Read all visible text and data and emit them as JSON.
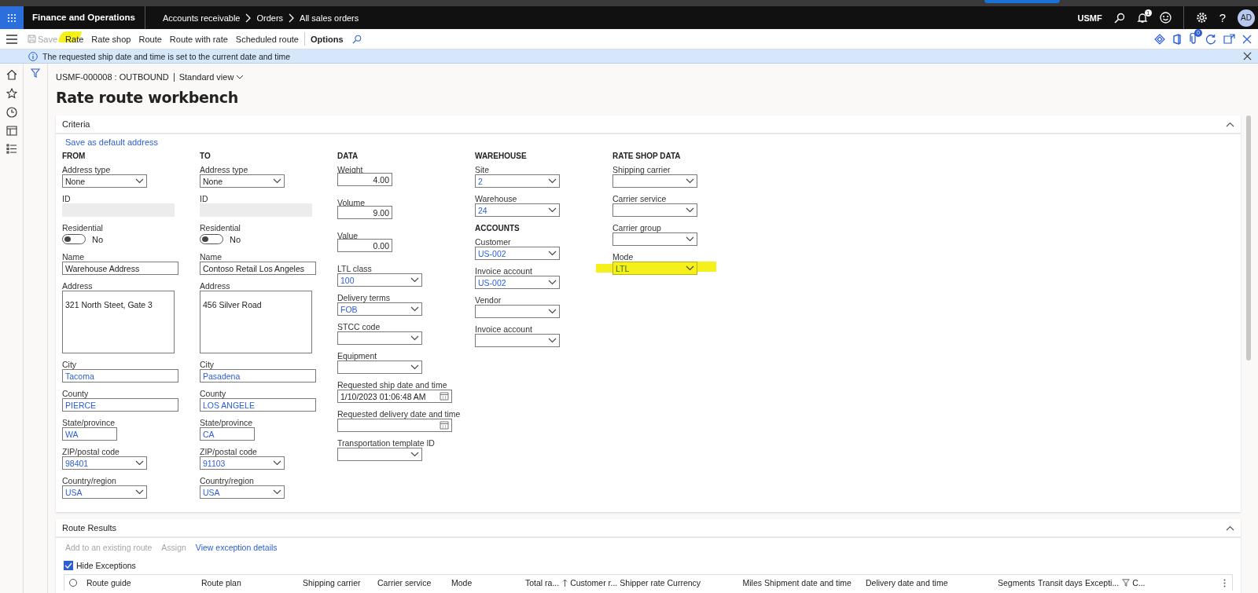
{
  "app_bar": {
    "app_name": "Finance and Operations",
    "breadcrumb": [
      "Accounts receivable",
      "Orders",
      "All sales orders"
    ],
    "company": "USMF",
    "notification_count": "1",
    "avatar": "AD",
    "help": "?"
  },
  "toolbar": {
    "actions": [
      {
        "label": "Save",
        "disabled": true,
        "highlighted": false
      },
      {
        "label": "Rate",
        "disabled": false,
        "highlighted": true
      },
      {
        "label": "Rate shop",
        "disabled": false,
        "highlighted": false
      },
      {
        "label": "Route",
        "disabled": false,
        "highlighted": false
      },
      {
        "label": "Route with rate",
        "disabled": false,
        "highlighted": false
      },
      {
        "label": "Scheduled route",
        "disabled": false,
        "highlighted": false
      }
    ],
    "options": "Options",
    "attachment_count": "0"
  },
  "message_bar": {
    "text": "The requested ship date and time is set to the current date and time"
  },
  "page": {
    "context": "USMF-000008 : OUTBOUND",
    "view": "Standard view",
    "title": "Rate route workbench"
  },
  "criteria": {
    "title": "Criteria",
    "expanded": true,
    "link": "Save as default address",
    "columns": [
      {
        "groups": [
          {
            "heading": "FROM",
            "fields": [
              {
                "label": "Address type",
                "kind": "enum",
                "value": "None"
              },
              {
                "label": "ID",
                "kind": "readonly"
              },
              {
                "label": "Residential",
                "kind": "toggle",
                "on": false,
                "value": "No"
              },
              {
                "label": "Name",
                "kind": "text",
                "value": "Warehouse Address"
              },
              {
                "label": "Address",
                "kind": "textarea",
                "value": "321 North Steet, Gate 3"
              },
              {
                "label": "City",
                "kind": "link-text",
                "value": "Tacoma"
              },
              {
                "label": "County",
                "kind": "link-text",
                "value": "PIERCE"
              },
              {
                "label": "State/province",
                "kind": "code",
                "value": "WA"
              },
              {
                "label": "ZIP/postal code",
                "kind": "lookup",
                "value": "98401"
              },
              {
                "label": "Country/region",
                "kind": "lookup",
                "value": "USA"
              }
            ]
          }
        ]
      },
      {
        "groups": [
          {
            "heading": "TO",
            "fields": [
              {
                "label": "Address type",
                "kind": "enum",
                "value": "None"
              },
              {
                "label": "ID",
                "kind": "readonly"
              },
              {
                "label": "Residential",
                "kind": "toggle",
                "on": false,
                "value": "No"
              },
              {
                "label": "Name",
                "kind": "text",
                "value": "Contoso Retail Los Angeles"
              },
              {
                "label": "Address",
                "kind": "textarea",
                "value": "456 Silver Road"
              },
              {
                "label": "City",
                "kind": "link-text",
                "value": "Pasadena"
              },
              {
                "label": "County",
                "kind": "link-text",
                "value": "LOS ANGELE"
              },
              {
                "label": "State/province",
                "kind": "code",
                "value": "CA"
              },
              {
                "label": "ZIP/postal code",
                "kind": "lookup",
                "value": "91103"
              },
              {
                "label": "Country/region",
                "kind": "lookup",
                "value": "USA"
              }
            ]
          }
        ]
      },
      {
        "groups": [
          {
            "heading": "DATA",
            "fields": [
              {
                "label": "Weight",
                "kind": "number",
                "value": "4.00"
              },
              {
                "label": "Volume",
                "kind": "number",
                "value": "9.00"
              },
              {
                "label": "Value",
                "kind": "number",
                "value": "0.00"
              },
              {
                "label": "LTL class",
                "kind": "lookup",
                "value": "100"
              },
              {
                "label": "Delivery terms",
                "kind": "lookup",
                "value": "FOB"
              },
              {
                "label": "STCC code",
                "kind": "lookup"
              },
              {
                "label": "Equipment",
                "kind": "lookup"
              },
              {
                "label": "Requested ship date and time",
                "kind": "date",
                "value": "1/10/2023 01:06:48 AM"
              },
              {
                "label": "Requested delivery date and time",
                "kind": "date"
              },
              {
                "label": "Transportation template ID",
                "kind": "lookup"
              }
            ]
          }
        ]
      },
      {
        "groups": [
          {
            "heading": "WAREHOUSE",
            "fields": [
              {
                "label": "Site",
                "kind": "lookup",
                "value": "2"
              },
              {
                "label": "Warehouse",
                "kind": "lookup",
                "value": "24"
              }
            ]
          },
          {
            "heading": "ACCOUNTS",
            "fields": [
              {
                "label": "Customer",
                "kind": "lookup",
                "value": "US-002"
              },
              {
                "label": "Invoice account",
                "kind": "lookup",
                "value": "US-002"
              },
              {
                "label": "Vendor",
                "kind": "lookup"
              },
              {
                "label": "Invoice account",
                "kind": "lookup"
              }
            ]
          }
        ]
      },
      {
        "groups": [
          {
            "heading": "RATE SHOP DATA",
            "fields": [
              {
                "label": "Shipping carrier",
                "kind": "lookup"
              },
              {
                "label": "Carrier service",
                "kind": "lookup"
              },
              {
                "label": "Carrier group",
                "kind": "lookup"
              },
              {
                "label": "Mode",
                "kind": "enum",
                "value": "LTL",
                "highlighted": true
              }
            ]
          }
        ]
      }
    ]
  },
  "route_results": {
    "title": "Route Results",
    "expanded": true,
    "actions": [
      {
        "label": "Add to an existing route",
        "disabled": true
      },
      {
        "label": "Assign",
        "disabled": true
      },
      {
        "label": "View exception details",
        "disabled": false
      }
    ],
    "hide_exceptions": {
      "label": "Hide Exceptions",
      "checked": true
    },
    "all_selected": false,
    "columns": [
      {
        "label": "Route guide",
        "sorted": false,
        "filtered": false
      },
      {
        "label": "Route plan",
        "sorted": false,
        "filtered": false
      },
      {
        "label": "Shipping carrier",
        "sorted": false,
        "filtered": false
      },
      {
        "label": "Carrier service",
        "sorted": false,
        "filtered": false
      },
      {
        "label": "Mode",
        "sorted": false,
        "filtered": false
      },
      {
        "label": "Total ra...",
        "sorted": true,
        "filtered": false
      },
      {
        "label": "Customer r...",
        "sorted": false,
        "filtered": false
      },
      {
        "label": "Shipper rate",
        "sorted": false,
        "filtered": false
      },
      {
        "label": "Currency",
        "sorted": false,
        "filtered": false
      },
      {
        "label": "Miles",
        "sorted": false,
        "filtered": false
      },
      {
        "label": "Shipment date and time",
        "sorted": false,
        "filtered": false
      },
      {
        "label": "Delivery date and time",
        "sorted": false,
        "filtered": false
      },
      {
        "label": "Segments",
        "sorted": false,
        "filtered": false
      },
      {
        "label": "Transit days",
        "sorted": false,
        "filtered": false
      },
      {
        "label": "Excepti...",
        "sorted": false,
        "filtered": true
      },
      {
        "label": "C...",
        "sorted": false,
        "filtered": false
      }
    ]
  }
}
